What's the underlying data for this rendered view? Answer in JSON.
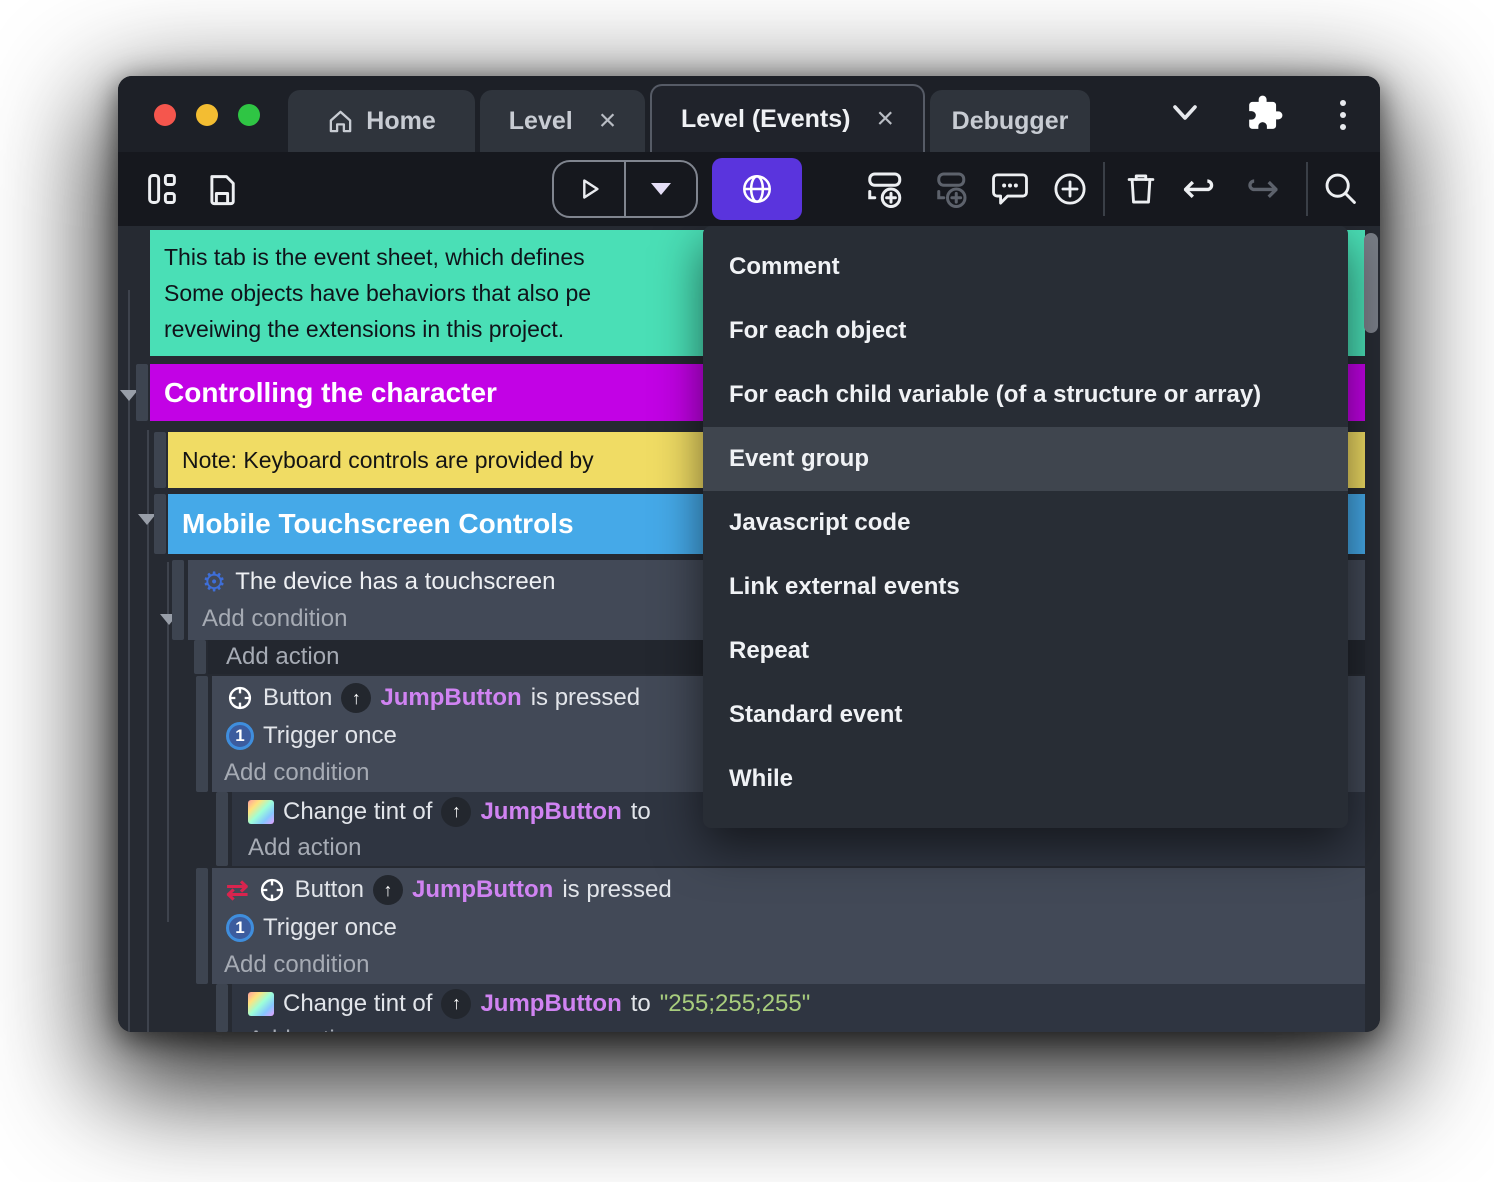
{
  "titlebar": {
    "tabs": [
      {
        "label": "Home"
      },
      {
        "label": "Level",
        "close": "×"
      },
      {
        "label": "Level (Events)",
        "close": "×"
      },
      {
        "label": "Debugger"
      }
    ]
  },
  "menu": {
    "items": [
      {
        "label": "Comment"
      },
      {
        "label": "For each object"
      },
      {
        "label": "For each child variable (of a structure or array)"
      },
      {
        "label": "Event group",
        "highlighted": true
      },
      {
        "label": "Javascript code"
      },
      {
        "label": "Link external events"
      },
      {
        "label": "Repeat"
      },
      {
        "label": "Standard event"
      },
      {
        "label": "While"
      }
    ]
  },
  "sheet": {
    "comment": {
      "line1": "This tab is the event sheet, which defines",
      "line2": "Some objects have behaviors that also pe",
      "line3": "reveiwing the extensions in this project."
    },
    "group_controlling": "Controlling the character",
    "note_keyboard": "Note: Keyboard controls are provided by",
    "group_mobile": "Mobile Touchscreen Controls",
    "labels": {
      "add_condition": "Add condition",
      "add_action": "Add action",
      "trigger_once": "Trigger once"
    },
    "cond_touchscreen": "The device has a touchscreen",
    "evt_button": {
      "pre": "Button",
      "object": "JumpButton",
      "post": "is pressed"
    },
    "act_tint": {
      "pre": "Change tint of",
      "object": "JumpButton",
      "to": "to",
      "value": "\"255;255;255\""
    }
  },
  "icons": {
    "gear": "⚙",
    "invert": "⇄",
    "object_arrow": "↑",
    "trigger_once": "1",
    "undo": "↩",
    "redo": "↪"
  },
  "colors": {
    "accent_purple": "#5a34dd",
    "comment_teal": "#4adfb6",
    "group_magenta": "#c202e5",
    "note_yellow": "#f0dc64",
    "group_blue": "#45a9e8",
    "object_pink": "#d083f2",
    "string_green": "#a8cd7d",
    "invert_red": "#d9244e",
    "traffic_red": "#f5564d",
    "traffic_yellow": "#f3bd32",
    "traffic_green": "#2fc544"
  }
}
